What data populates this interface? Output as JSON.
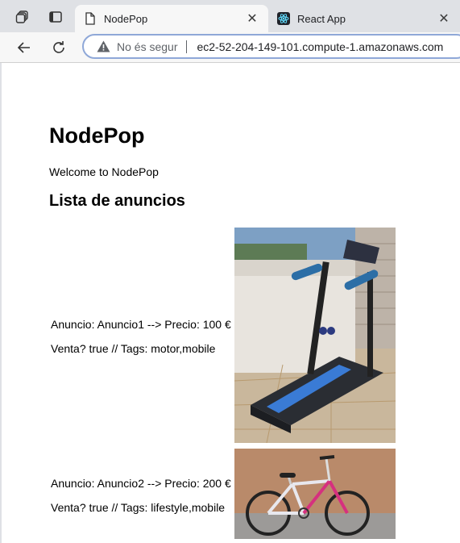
{
  "browser": {
    "tabs": [
      {
        "title": "NodePop",
        "active": true
      },
      {
        "title": "React App",
        "active": false
      }
    ],
    "address": {
      "security_label": "No és segur",
      "url": "ec2-52-204-149-101.compute-1.amazonaws.com"
    }
  },
  "page": {
    "title": "NodePop",
    "welcome": "Welcome to NodePop",
    "list_heading": "Lista de anuncios",
    "ads": [
      {
        "line1": "Anuncio: Anuncio1 --> Precio: 100 €",
        "line2": "Venta? true // Tags: motor,mobile",
        "image": "treadmill-photo"
      },
      {
        "line1": "Anuncio: Anuncio2 --> Precio: 200 €",
        "line2": "Venta? true // Tags: lifestyle,mobile",
        "image": "bicycle-photo"
      }
    ]
  }
}
